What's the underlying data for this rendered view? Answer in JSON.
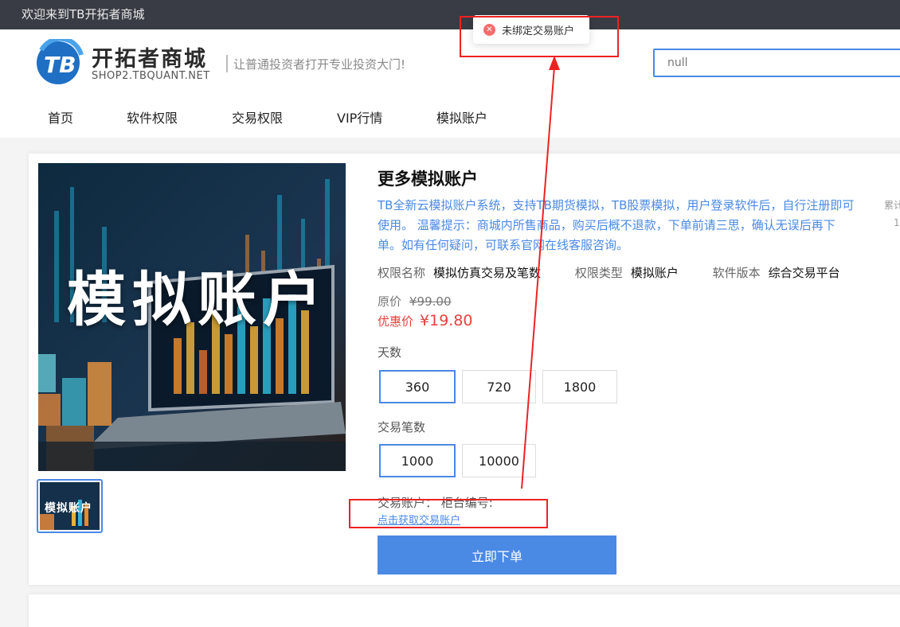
{
  "topbar": {
    "welcome": "欢迎来到TB开拓者商城"
  },
  "header": {
    "logo_mark": "TB",
    "logo_name": "开拓者商城",
    "logo_url": "SHOP2.TBQUANT.NET",
    "slogan": "让普通投资者打开专业投资大门!",
    "search_value": "null"
  },
  "nav": [
    "首页",
    "软件权限",
    "交易权限",
    "VIP行情",
    "模拟账户"
  ],
  "product": {
    "image_text": "模拟账户",
    "thumb_text": "模拟账户",
    "title": "更多模拟账户",
    "description": "TB全新云模拟账户系统，支持TB期货模拟，TB股票模拟，用户登录软件后，自行注册即可使用。 温馨提示：商城内所售商品，购买后概不退款，下单前请三思，确认无误后再下单。如有任何疑问，可联系官网在线客服咨询。",
    "side_label": "累计",
    "side_value": "1",
    "attrs": [
      {
        "label": "权限名称",
        "value": "模拟仿真交易及笔数"
      },
      {
        "label": "权限类型",
        "value": "模拟账户"
      },
      {
        "label": "软件版本",
        "value": "综合交易平台"
      }
    ],
    "original_price_label": "原价",
    "original_price": "¥99.00",
    "sale_price_label": "优惠价",
    "sale_price": "¥19.80",
    "days_label": "天数",
    "days_options": [
      "360",
      "720",
      "1800"
    ],
    "days_selected": "360",
    "trades_label": "交易笔数",
    "trades_options": [
      "1000",
      "10000"
    ],
    "trades_selected": "1000",
    "account_text": "交易账户：   柜台编号:",
    "account_link": "点击获取交易账户",
    "order_button": "立即下单"
  },
  "toast": {
    "message": "未绑定交易账户",
    "icon": "error-circle-icon"
  },
  "colors": {
    "accent": "#4a89e4",
    "price": "#e8413c",
    "annotation": "#ee2222",
    "topbar": "#393c44"
  }
}
